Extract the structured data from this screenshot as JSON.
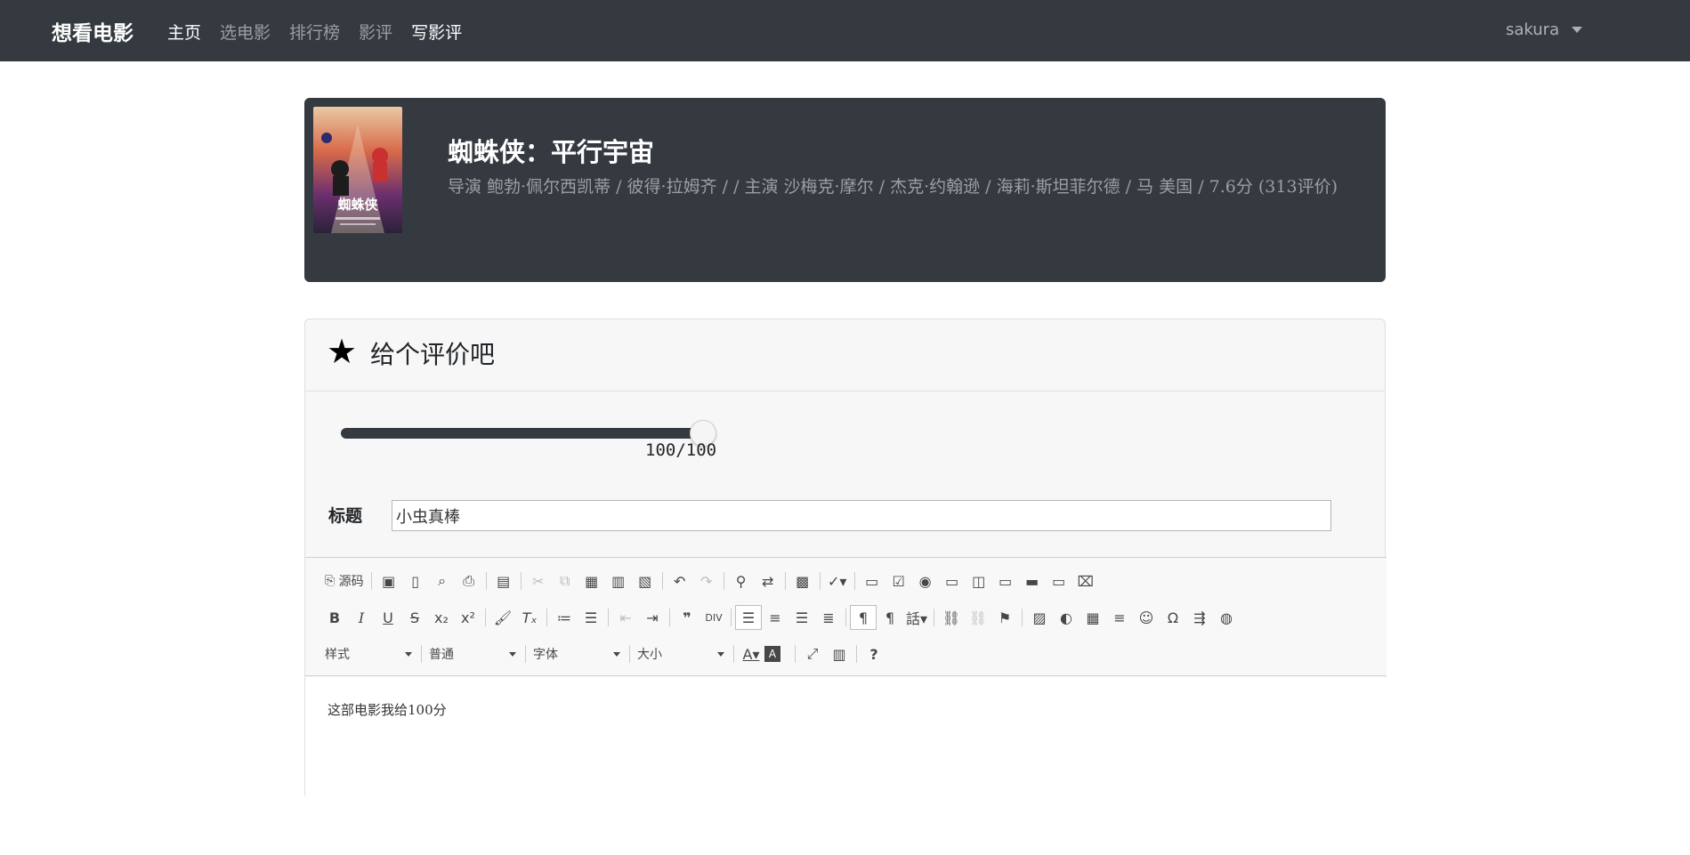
{
  "nav": {
    "brand": "想看电影",
    "links": [
      "主页",
      "选电影",
      "排行榜",
      "影评",
      "写影评"
    ],
    "user": "sakura"
  },
  "movie": {
    "title": "蜘蛛侠：平行宇宙",
    "meta": "导演 鲍勃·佩尔西凯蒂 / 彼得·拉姆齐 / / 主演 沙梅克·摩尔 / 杰克·约翰逊 / 海莉·斯坦菲尔德 / 马 美国 / 7.6分 (313评价)",
    "poster_text": "蜘蛛侠"
  },
  "rating": {
    "header": "给个评价吧",
    "score": 100,
    "max": 100,
    "display": "100/100",
    "title_label": "标题",
    "title_value": "小虫真棒"
  },
  "editor": {
    "source_label": "源码",
    "combos": [
      "样式",
      "普通",
      "字体",
      "大小"
    ],
    "content": "这部电影我给100分"
  }
}
